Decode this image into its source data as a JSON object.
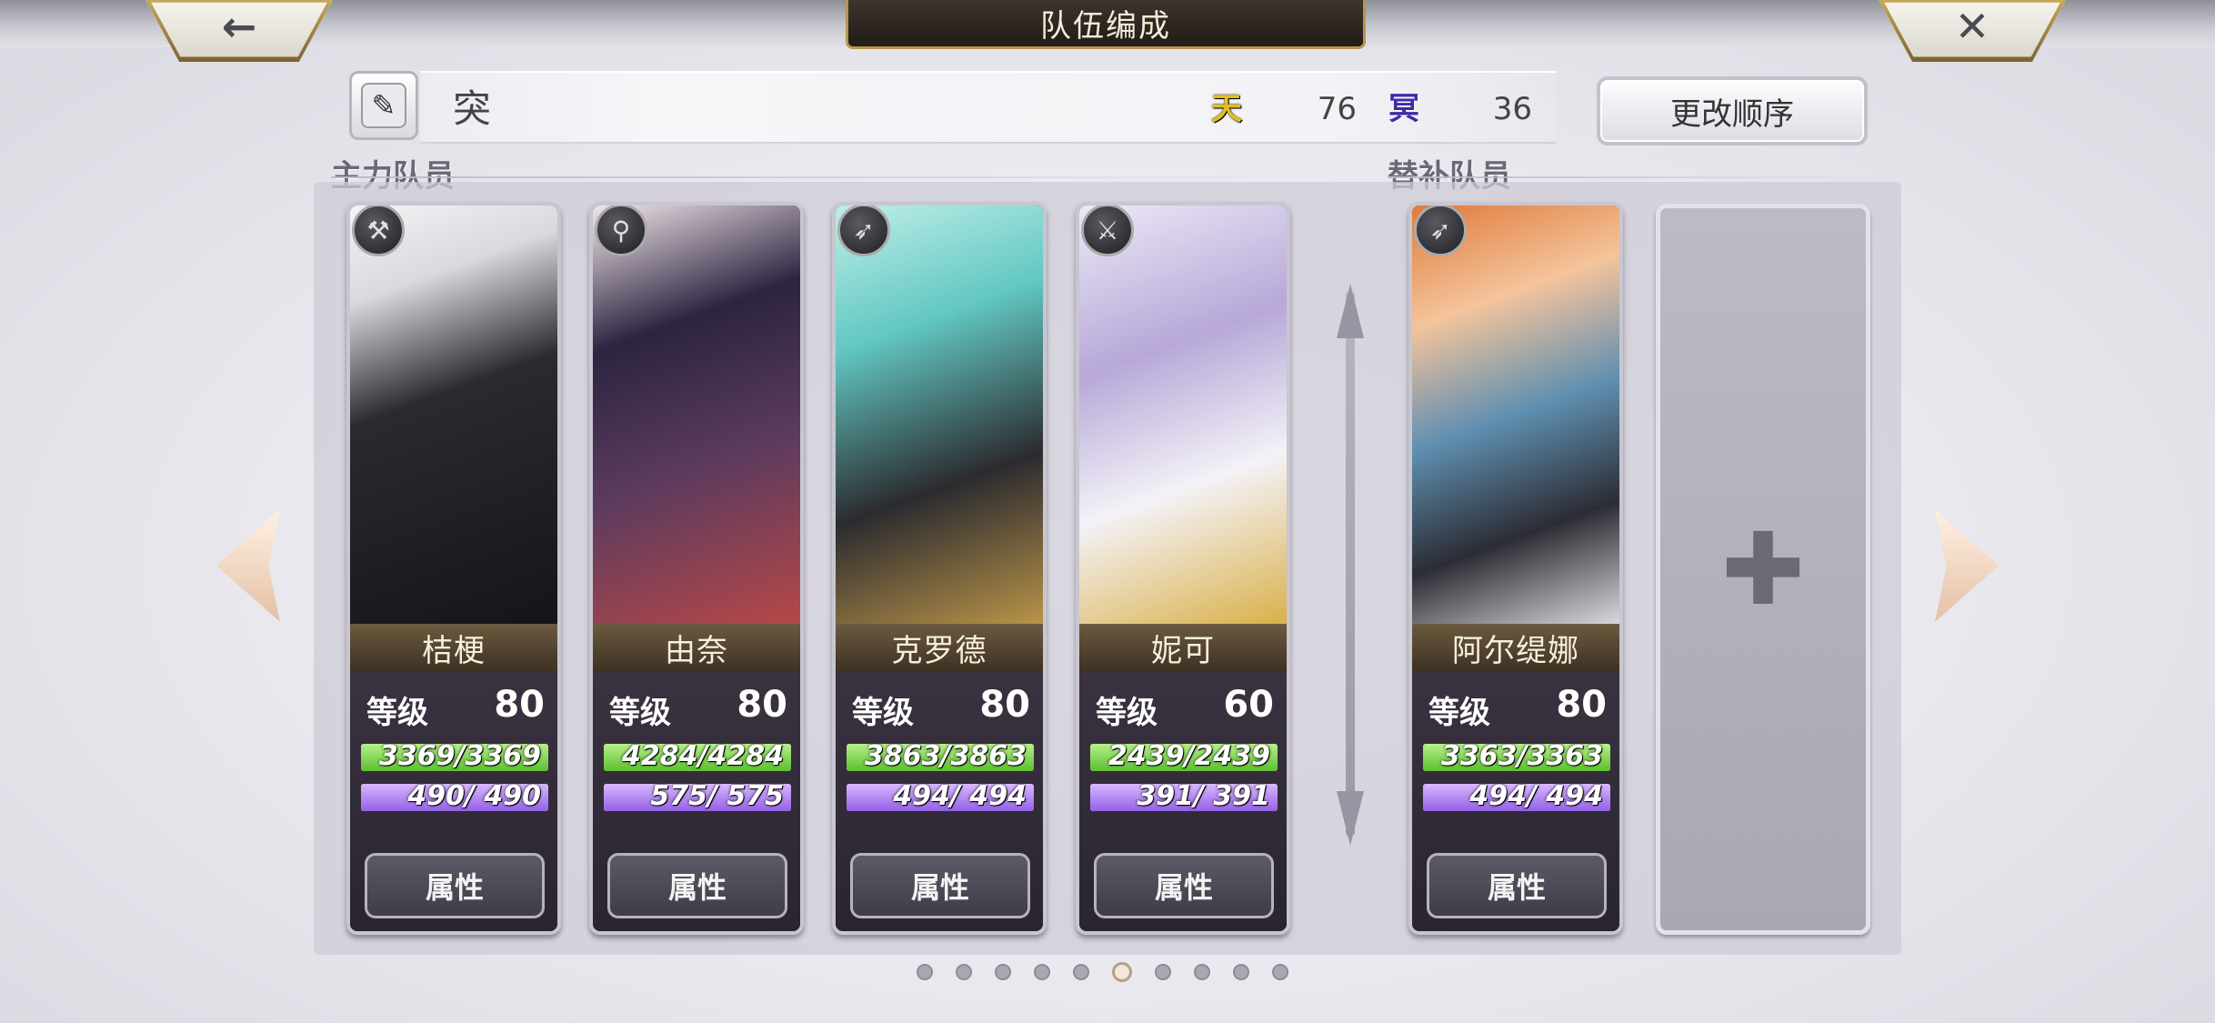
{
  "header": {
    "title": "队伍编成",
    "back_icon": "←",
    "close_icon": "✕"
  },
  "team": {
    "name": "突",
    "heaven_icon": "天",
    "heaven_value": "76",
    "hell_icon": "冥",
    "hell_value": "36",
    "reorder_label": "更改顺序",
    "edit_icon": "✎"
  },
  "sections": {
    "main_label": "主力队员",
    "sub_label": "替补队员"
  },
  "members": [
    {
      "name": "桔梗",
      "class_icon": "axe-class-icon",
      "class_glyph": "⚒",
      "level_label": "等级",
      "level": "80",
      "hp": "3369/3369",
      "hp_pct": 100,
      "mp": "490/ 490",
      "mp_pct": 100,
      "attr_label": "属性"
    },
    {
      "name": "由奈",
      "class_icon": "staff-class-icon",
      "class_glyph": "⚲",
      "level_label": "等级",
      "level": "80",
      "hp": "4284/4284",
      "hp_pct": 100,
      "mp": "575/ 575",
      "mp_pct": 100,
      "attr_label": "属性"
    },
    {
      "name": "克罗德",
      "class_icon": "bow-class-icon",
      "class_glyph": "➶",
      "level_label": "等级",
      "level": "80",
      "hp": "3863/3863",
      "hp_pct": 100,
      "mp": "494/ 494",
      "mp_pct": 100,
      "attr_label": "属性"
    },
    {
      "name": "妮可",
      "class_icon": "sword-class-icon",
      "class_glyph": "⚔",
      "level_label": "等级",
      "level": "60",
      "hp": "2439/2439",
      "hp_pct": 100,
      "mp": "391/ 391",
      "mp_pct": 100,
      "attr_label": "属性"
    }
  ],
  "substitute": {
    "name": "阿尔缇娜",
    "class_icon": "bow-class-icon",
    "class_glyph": "➶",
    "level_label": "等级",
    "level": "80",
    "hp": "3363/3363",
    "hp_pct": 100,
    "mp": "494/ 494",
    "mp_pct": 100,
    "attr_label": "属性"
  },
  "empty_slot": {
    "plus": "✚"
  },
  "pager": {
    "total": 10,
    "active_index": 5
  },
  "colors": {
    "hp": "#5cbf30",
    "mp": "#9560e6",
    "heaven": "#e0c020",
    "hell": "#3c2aa8",
    "gold_trim": "#b8954f"
  }
}
